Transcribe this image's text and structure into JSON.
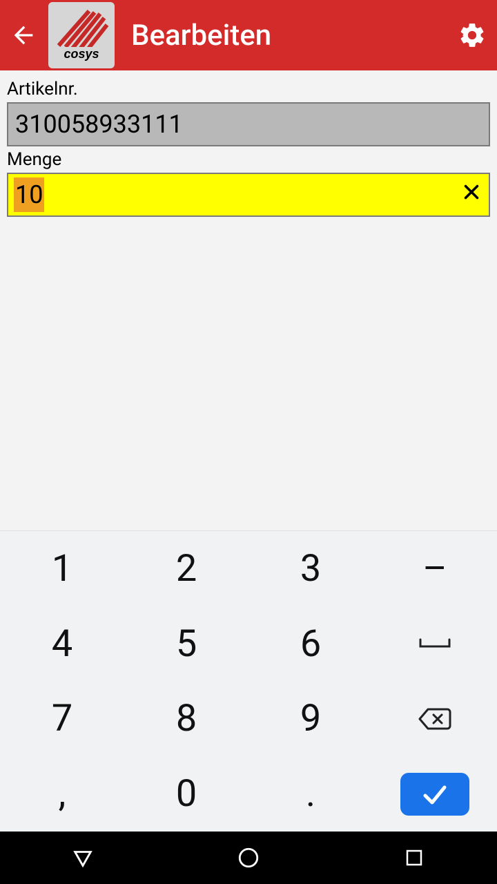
{
  "header": {
    "title": "Bearbeiten"
  },
  "fields": {
    "artikel_label": "Artikelnr.",
    "artikel_value": "310058933111",
    "menge_label": "Menge",
    "menge_value": "10"
  },
  "keypad": {
    "k1": "1",
    "k2": "2",
    "k3": "3",
    "dash": "–",
    "k4": "4",
    "k5": "5",
    "k6": "6",
    "k7": "7",
    "k8": "8",
    "k9": "9",
    "comma": ",",
    "k0": "0",
    "dot": "."
  }
}
